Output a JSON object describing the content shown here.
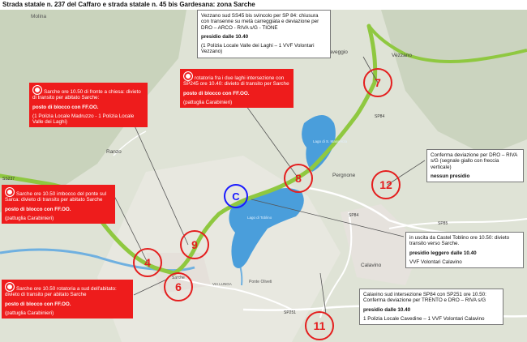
{
  "title": "Strada statale n. 237 del Caffaro e strada statale n. 45 bis Gardesana: zona Sarche",
  "colors": {
    "closure_red": "#ee1c1c",
    "route_green": "#8fc840",
    "lake_blue": "#4a9edb",
    "c_blue": "#1a1aff"
  },
  "map_labels": {
    "molina": "Molina",
    "fraveggio": "Fraveggio",
    "vezzano": "Vezzano",
    "ranzo": "Ranzo",
    "lago_toblino": "Lago di Toblino",
    "lago_santa_massenza": "Lago di S. Massenza",
    "pergnone": "Pergnone",
    "calavino": "Calavino",
    "sarche": "Sarche",
    "ponte_oliveti": "Ponte Oliveti",
    "via_lunga": "VIA LUNGA",
    "ss237": "SS237",
    "sp84_a": "SP84",
    "sp84_b": "SP84",
    "sp85": "SP85",
    "sp251": "SP251"
  },
  "markers": [
    {
      "id": "m7",
      "label": "7"
    },
    {
      "id": "m8",
      "label": "8"
    },
    {
      "id": "m9",
      "label": "9"
    },
    {
      "id": "m4",
      "label": "4"
    },
    {
      "id": "m6",
      "label": "6"
    },
    {
      "id": "m12",
      "label": "12"
    },
    {
      "id": "m11",
      "label": "11"
    },
    {
      "id": "mc",
      "label": "C"
    }
  ],
  "callouts": {
    "c7": {
      "text": "Vezzano sud SS45 bis svincolo per SP 84: chiusura con transenne su metà carreggiata e deviazione per DRO – ARCO - RIVA s/G - TIONE",
      "presidio": "presidio dalle 10.40",
      "detail": "(1 Polizia Locale Valle dei Laghi – 1 VVF Volontari Vezzano)"
    },
    "c8": {
      "text": "rotatoria fra i due laghi intersezione con SP245 ore 10.40: divieto di transito per Sarche",
      "block": "posto di blocco con FF.OO.",
      "detail": "(pattuglia Carabinieri)"
    },
    "c9": {
      "text": "Sarche ore 10.50 di fronte a chiesa: divieto di transito per abitato Sarche:",
      "block": "posto di blocco con FF.OO.",
      "detail": "(1 Polizia Locale Madruzzo - 1 Polizia Locale Valle dei Laghi)"
    },
    "c4": {
      "text": "Sarche ore 10.50 imbocco del ponte sul Sarca: divieto di transito per abitato Sarche",
      "block": "posto di blocco con FF.OO.",
      "detail": "(pattuglia Carabinieri)"
    },
    "c6": {
      "text": "Sarche ore 10.50 rotatoria a sud dell'abitato: divieto di transito per abitato Sarche",
      "block": "posto di blocco con FF.OO.",
      "detail": "(pattuglia Carabinieri)"
    },
    "c12": {
      "text": "Conferma deviazione per DRO – RIVA s/G (segnale giallo con freccia verticale)",
      "presidio": "nessun presidio"
    },
    "cC": {
      "text": "in uscita da Castel Toblino ore 10.50: divieto transito verso Sarche.",
      "presidio": "presidio leggero dalle 10.40",
      "detail": "VVF Volontari Calavino"
    },
    "c11": {
      "text": "Calavino sud intersezione SP84 con SP251 ore 10.50: Conferma deviazione per TRENTO e DRO – RIVA s/G",
      "presidio": "presidio dalle 10.40",
      "detail": "1 Polizia Locale Cavedine – 1 VVF Volontari Calavino"
    }
  }
}
